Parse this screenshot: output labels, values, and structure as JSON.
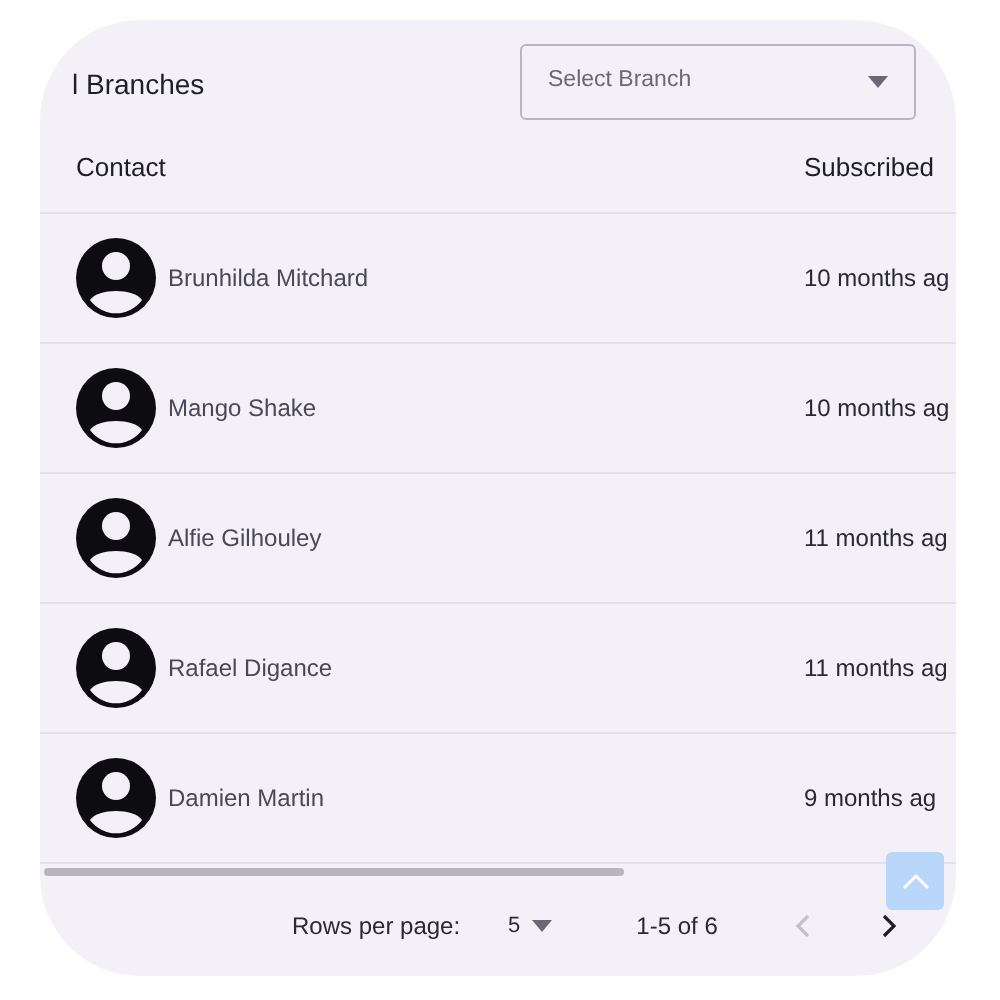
{
  "title": "l Branches",
  "branch_select": {
    "placeholder": "Select Branch"
  },
  "table": {
    "columns": [
      "Contact",
      "Subscribed"
    ],
    "rows": [
      {
        "contact": "Brunhilda Mitchard",
        "subscribed": "10 months ag"
      },
      {
        "contact": "Mango Shake",
        "subscribed": "10 months ag"
      },
      {
        "contact": "Alfie Gilhouley",
        "subscribed": "11 months ag"
      },
      {
        "contact": "Rafael Digance",
        "subscribed": "11 months ag"
      },
      {
        "contact": "Damien Martin",
        "subscribed": "9 months ag"
      }
    ]
  },
  "pagination": {
    "rows_per_page_label": "Rows per page:",
    "rows_per_page": "5",
    "range": "1-5 of 6"
  }
}
